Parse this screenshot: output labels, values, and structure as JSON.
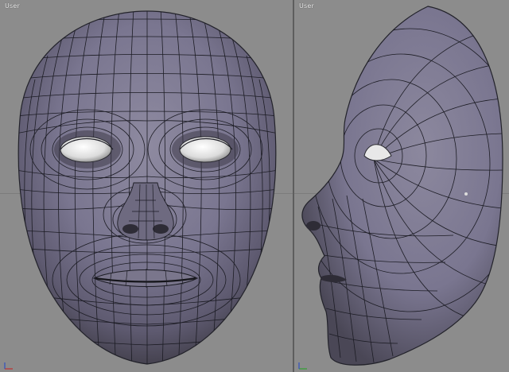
{
  "viewports": [
    {
      "id": "front",
      "label": "User",
      "view": "front"
    },
    {
      "id": "side",
      "label": "User",
      "view": "side"
    }
  ],
  "colors": {
    "background": "#8c8c8c",
    "mesh_fill": "#7e7a90",
    "mesh_shade": "#4e4a5c",
    "wire": "#1a1a22",
    "eye": "#ececec",
    "divider": "#5e5e5e"
  }
}
